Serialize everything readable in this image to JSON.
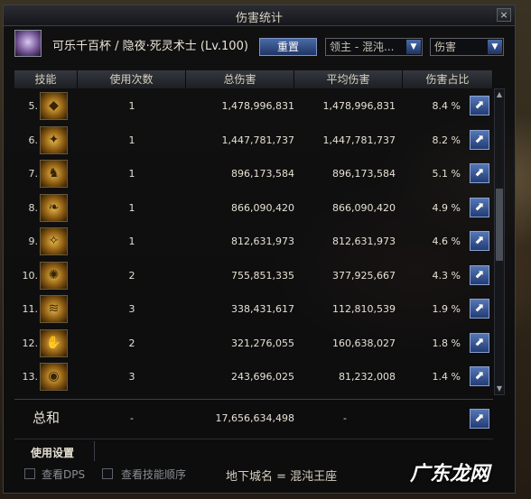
{
  "window": {
    "title": "伤害统计",
    "close_label": "×"
  },
  "user": {
    "name": "可乐千百杯 / 隐夜·死灵术士 (Lv.100)"
  },
  "controls": {
    "reset_label": "重置",
    "target_dropdown": "领主 - 混沌...",
    "metric_dropdown": "伤害",
    "arrow": "▼"
  },
  "table": {
    "headers": [
      "技能",
      "使用次数",
      "总伤害",
      "平均伤害",
      "伤害占比"
    ],
    "rows": [
      {
        "rank": "5.",
        "skill_icon": "golden-mask-icon",
        "uses": "1",
        "total": "1,478,996,831",
        "avg": "1,478,996,831",
        "pct": "8.4 %"
      },
      {
        "rank": "6.",
        "skill_icon": "golden-figure-icon",
        "uses": "1",
        "total": "1,447,781,737",
        "avg": "1,447,781,737",
        "pct": "8.2 %"
      },
      {
        "rank": "7.",
        "skill_icon": "golden-knight-icon",
        "uses": "1",
        "total": "896,173,584",
        "avg": "896,173,584",
        "pct": "5.1 %"
      },
      {
        "rank": "8.",
        "skill_icon": "golden-wing-icon",
        "uses": "1",
        "total": "866,090,420",
        "avg": "866,090,420",
        "pct": "4.9 %"
      },
      {
        "rank": "9.",
        "skill_icon": "golden-claw-icon",
        "uses": "1",
        "total": "812,631,973",
        "avg": "812,631,973",
        "pct": "4.6 %"
      },
      {
        "rank": "10.",
        "skill_icon": "golden-burst-icon",
        "uses": "2",
        "total": "755,851,335",
        "avg": "377,925,667",
        "pct": "4.3 %"
      },
      {
        "rank": "11.",
        "skill_icon": "golden-slash-icon",
        "uses": "3",
        "total": "338,431,617",
        "avg": "112,810,539",
        "pct": "1.9 %"
      },
      {
        "rank": "12.",
        "skill_icon": "golden-hand-icon",
        "uses": "2",
        "total": "321,276,055",
        "avg": "160,638,027",
        "pct": "1.8 %"
      },
      {
        "rank": "13.",
        "skill_icon": "golden-eye-icon",
        "uses": "3",
        "total": "243,696,025",
        "avg": "81,232,008",
        "pct": "1.4 %"
      }
    ]
  },
  "summary": {
    "label": "总和",
    "uses": "-",
    "total": "17,656,634,498",
    "avg": "-"
  },
  "settings": {
    "label": "使用设置"
  },
  "options": {
    "dps_label": "查看DPS",
    "order_label": "查看技能顺序"
  },
  "dungeon": {
    "label": "地下城名 = 混沌王座"
  },
  "watermark": {
    "text": "广东龙网"
  },
  "icons": {
    "share": "share-icon",
    "share_glyph": "⬈"
  }
}
